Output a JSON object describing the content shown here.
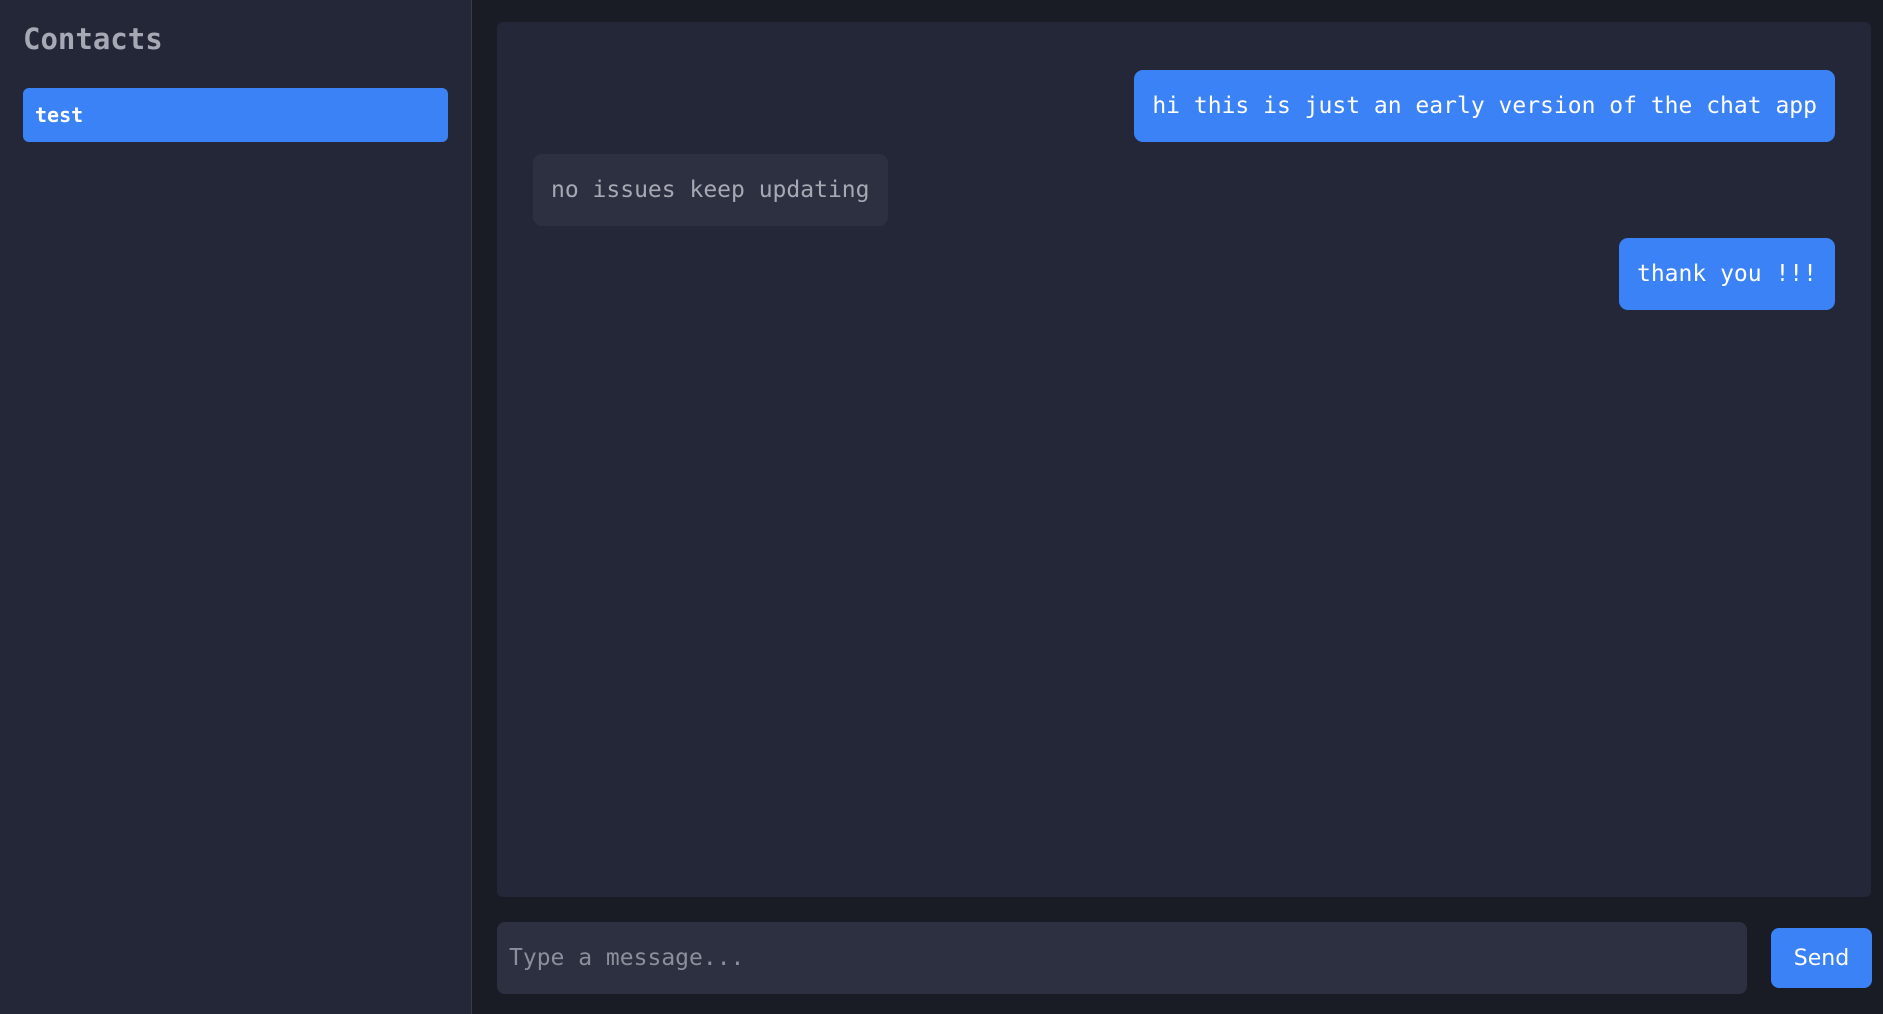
{
  "sidebar": {
    "title": "Contacts",
    "contacts": [
      {
        "name": "test",
        "active": true
      }
    ]
  },
  "chat": {
    "messages": [
      {
        "text": "hi this is just an early version of the chat app",
        "direction": "outgoing"
      },
      {
        "text": "no issues keep updating",
        "direction": "incoming"
      },
      {
        "text": "thank you !!!",
        "direction": "outgoing"
      }
    ]
  },
  "composer": {
    "placeholder": "Type a message...",
    "value": "",
    "send_label": "Send"
  },
  "colors": {
    "accent": "#3b82f6",
    "panel": "#242738",
    "background": "#1a1c25",
    "incoming_bubble": "#2d3040",
    "muted_text": "#a6a9b3"
  }
}
